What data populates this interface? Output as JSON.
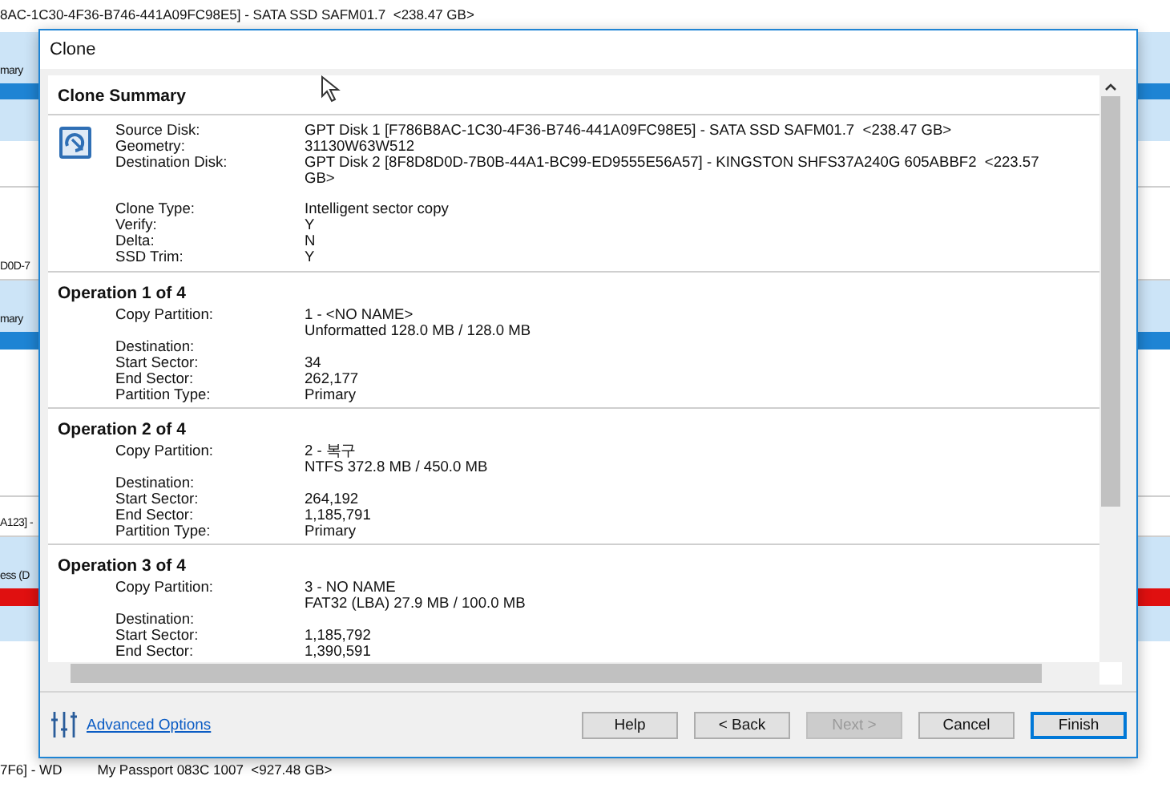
{
  "background": {
    "top_text": "8AC-1C30-4F36-B746-441A09FC98E5] - SATA SSD SAFM01.7  <238.47 GB>",
    "row_texts": [
      "mary",
      "D0D-7",
      "mary",
      "A123] -",
      "ess (D"
    ],
    "bottom_texts": [
      "7F6] - WD",
      "My Passport 083C 1007  <927.48 GB>"
    ]
  },
  "dialog": {
    "title": "Clone",
    "summary": {
      "heading": "Clone Summary",
      "groups": [
        [
          {
            "label": "Source Disk:",
            "values": [
              "GPT Disk 1 [F786B8AC-1C30-4F36-B746-441A09FC98E5] - SATA SSD SAFM01.7  <238.47 GB>"
            ]
          },
          {
            "label": "Geometry:",
            "values": [
              "31130W63W512"
            ]
          },
          {
            "label": "Destination Disk:",
            "values": [
              "GPT Disk 2 [8F8D8D0D-7B0B-44A1-BC99-ED9555E56A57] - KINGSTON SHFS37A240G 605ABBF2  <223.57",
              "GB>"
            ]
          }
        ],
        [
          {
            "label": "Clone Type:",
            "values": [
              "Intelligent sector copy"
            ]
          },
          {
            "label": "Verify:",
            "values": [
              "Y"
            ]
          },
          {
            "label": "Delta:",
            "values": [
              "N"
            ]
          },
          {
            "label": "SSD Trim:",
            "values": [
              "Y"
            ]
          }
        ]
      ]
    },
    "operations": [
      {
        "heading": "Operation 1 of 4",
        "rows": [
          {
            "label": "Copy Partition:",
            "values": [
              "1 - <NO NAME>",
              "Unformatted 128.0 MB / 128.0 MB"
            ]
          },
          {
            "label": "Destination:",
            "values": []
          },
          {
            "label": "Start Sector:",
            "values": [
              "34"
            ]
          },
          {
            "label": "End Sector:",
            "values": [
              "262,177"
            ]
          },
          {
            "label": "Partition Type:",
            "values": [
              "Primary"
            ]
          }
        ]
      },
      {
        "heading": "Operation 2 of 4",
        "rows": [
          {
            "label": "Copy Partition:",
            "values": [
              "2 - 복구",
              "NTFS 372.8 MB / 450.0 MB"
            ]
          },
          {
            "label": "Destination:",
            "values": []
          },
          {
            "label": "Start Sector:",
            "values": [
              "264,192"
            ]
          },
          {
            "label": "End Sector:",
            "values": [
              "1,185,791"
            ]
          },
          {
            "label": "Partition Type:",
            "values": [
              "Primary"
            ]
          }
        ]
      },
      {
        "heading": "Operation 3 of 4",
        "rows": [
          {
            "label": "Copy Partition:",
            "values": [
              "3 - NO NAME",
              "FAT32 (LBA) 27.9 MB / 100.0 MB"
            ]
          },
          {
            "label": "Destination:",
            "values": []
          },
          {
            "label": "Start Sector:",
            "values": [
              "1,185,792"
            ]
          },
          {
            "label": "End Sector:",
            "values": [
              "1,390,591"
            ]
          }
        ]
      }
    ],
    "advanced_link": "Advanced Options",
    "buttons": [
      {
        "label": "Help",
        "disabled": false,
        "default": false
      },
      {
        "label": "< Back",
        "disabled": false,
        "default": false
      },
      {
        "label": "Next >",
        "disabled": true,
        "default": false
      },
      {
        "label": "Cancel",
        "disabled": false,
        "default": false
      },
      {
        "label": "Finish",
        "disabled": false,
        "default": true
      }
    ]
  }
}
